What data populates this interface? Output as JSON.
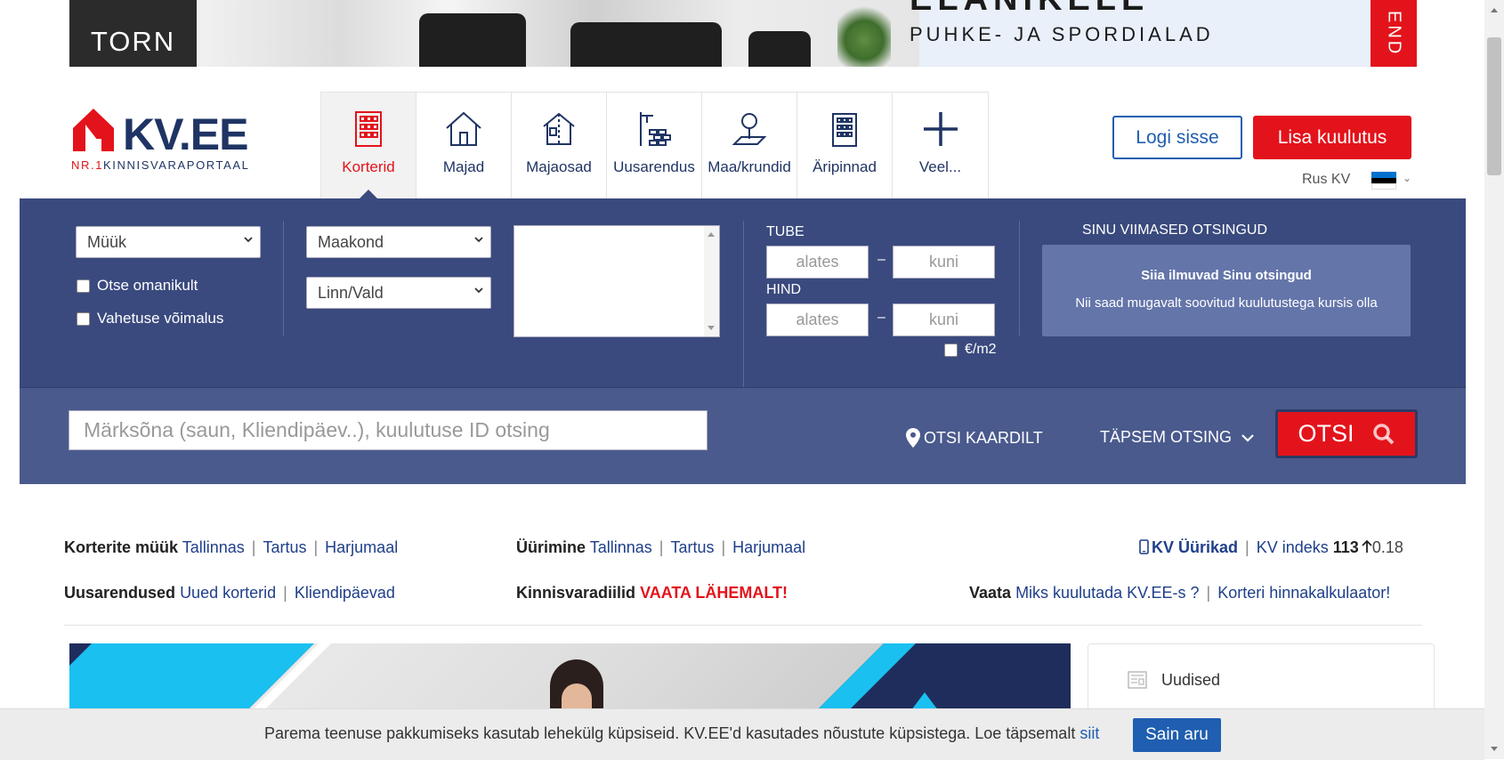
{
  "banner": {
    "brand": "TORN",
    "headline": "ELANIKELE",
    "tagline": "PUHKE- JA SPORDIALAD",
    "side_text": "END"
  },
  "header": {
    "logo_text": "KV.EE",
    "logo_sub_nr": "NR.1",
    "logo_sub_rest": "KINNISVARAPORTAAL",
    "categories": [
      {
        "label": "Korterid",
        "icon": "building-icon",
        "active": true
      },
      {
        "label": "Majad",
        "icon": "house-icon",
        "active": false
      },
      {
        "label": "Majaosad",
        "icon": "house-part-icon",
        "active": false
      },
      {
        "label": "Uusarendus",
        "icon": "construction-icon",
        "active": false
      },
      {
        "label": "Maa/krundid",
        "icon": "land-tree-icon",
        "active": false
      },
      {
        "label": "Äripinnad",
        "icon": "office-building-icon",
        "active": false
      },
      {
        "label": "Veel...",
        "icon": "plus-icon",
        "active": false
      }
    ],
    "login_label": "Logi sisse",
    "add_label": "Lisa kuulutus",
    "lang_label": "Rus KV"
  },
  "search": {
    "deal_type": "Müük",
    "county": "Maakond",
    "city": "Linn/Vald",
    "owner_label": "Otse omanikult",
    "exchange_label": "Vahetuse võimalus",
    "rooms_label": "TUBE",
    "price_label": "HIND",
    "from_placeholder": "alates",
    "to_placeholder": "kuni",
    "per_m2_label": "€/m2",
    "dash": "–",
    "recent_title": "SINU VIIMASED OTSINGUD",
    "recent_line1": "Siia ilmuvad Sinu otsingud",
    "recent_line2": "Nii saad mugavalt soovitud kuulutustega kursis olla",
    "keyword_placeholder": "Märksõna (saun, Kliendipäev..), kuulutuse ID otsing",
    "map_label": "OTSI KAARDILT",
    "advanced_label": "TÄPSEM OTSING",
    "search_button": "OTSI"
  },
  "quick_links": {
    "row1_col1_title": "Korterite müük",
    "row1_col1_links": [
      "Tallinnas",
      "Tartus",
      "Harjumaal"
    ],
    "row1_col2_title": "Üürimine",
    "row1_col2_links": [
      "Tallinnas",
      "Tartus",
      "Harjumaal"
    ],
    "row1_col3_link": "KV Üürikad",
    "row1_col3_index_label": "KV indeks",
    "row1_col3_index_value": "113",
    "row1_col3_index_change": "0.18",
    "row2_col1_title": "Uusarendused",
    "row2_col1_links": [
      "Uued korterid",
      "Kliendipäevad"
    ],
    "row2_col2_title": "Kinnisvaradiilid",
    "row2_col2_link": "VAATA LÄHEMALT!",
    "row2_col3_title": "Vaata",
    "row2_col3_links": [
      "Miks kuulutada KV.EE-s ?",
      "Korteri hinnakalkulaator!"
    ]
  },
  "news": {
    "title": "Uudised"
  },
  "cookie": {
    "text": "Parema teenuse pakkumiseks kasutab lehekülg küpsiseid. KV.EE'd kasutades nõustute küpsistega. Loe täpsemalt ",
    "link": "siit",
    "button": "Sain aru"
  },
  "colors": {
    "brand_red": "#e3131b",
    "brand_navy": "#1f3464",
    "panel_bg": "#3a4a7e",
    "link_blue": "#1f5eb0"
  }
}
